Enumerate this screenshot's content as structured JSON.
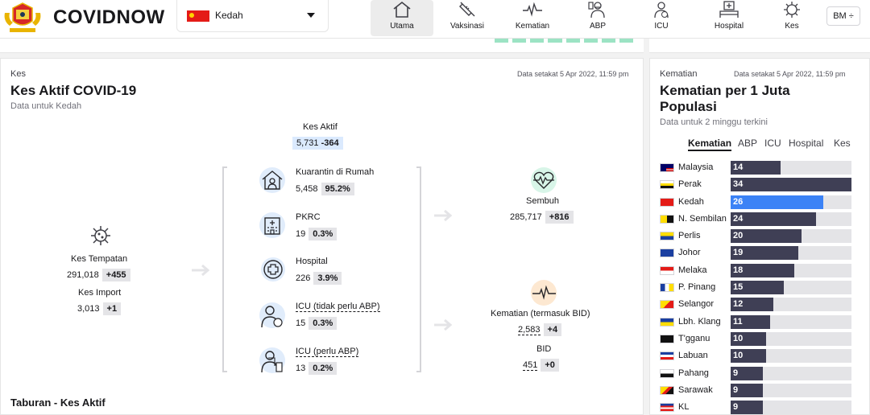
{
  "header": {
    "brand": "COVIDNOW",
    "state": "Kedah",
    "nav": [
      {
        "label": "Utama",
        "icon": "home-icon",
        "active": true
      },
      {
        "label": "Vaksinasi",
        "icon": "syringe-icon",
        "active": false
      },
      {
        "label": "Kematian",
        "icon": "pulse-icon",
        "active": false
      },
      {
        "label": "ABP",
        "icon": "ventilator-patient-icon",
        "active": false
      },
      {
        "label": "ICU",
        "icon": "icu-doctor-icon",
        "active": false
      },
      {
        "label": "Hospital",
        "icon": "hospital-bed-icon",
        "active": false
      },
      {
        "label": "Kes",
        "icon": "virus-icon",
        "active": false
      }
    ],
    "language": "BM ÷"
  },
  "active_cases": {
    "section_tag": "Kes",
    "updated": "Data setakat 5 Apr 2022, 11:59 pm",
    "title": "Kes Aktif COVID-19",
    "subtitle": "Data untuk Kedah",
    "total": {
      "label": "Kes Aktif",
      "value": "5,731",
      "delta": "-364"
    },
    "local": {
      "label": "Kes Tempatan",
      "value": "291,018",
      "delta": "+455"
    },
    "import": {
      "label": "Kes Import",
      "value": "3,013",
      "delta": "+1"
    },
    "breakdown": [
      {
        "label": "Kuarantin di Rumah",
        "value": "5,458",
        "pct": "95.2%",
        "icon": "home-quarantine-icon"
      },
      {
        "label": "PKRC",
        "value": "19",
        "pct": "0.3%",
        "icon": "quarantine-centre-icon"
      },
      {
        "label": "Hospital",
        "value": "226",
        "pct": "3.9%",
        "icon": "medical-cross-icon"
      },
      {
        "label": "ICU (tidak perlu ABP)",
        "value": "15",
        "pct": "0.3%",
        "icon": "icu-patient-icon"
      },
      {
        "label": "ICU (perlu ABP)",
        "value": "13",
        "pct": "0.2%",
        "icon": "icu-ventilator-icon"
      }
    ],
    "recovered": {
      "label": "Sembuh",
      "value": "285,717",
      "delta": "+816"
    },
    "deaths": {
      "label": "Kematian (termasuk BID)",
      "value": "2,583",
      "delta": "+4"
    },
    "bid": {
      "label": "BID",
      "value": "451",
      "delta": "+0"
    },
    "next_section": "Taburan - Kes Aktif"
  },
  "deaths_panel": {
    "section_tag": "Kematian",
    "updated": "Data setakat 5 Apr 2022, 11:59 pm",
    "title_line1": "Kematian per 1 Juta",
    "title_line2": "Populasi",
    "subtitle": "Data untuk 2 minggu terkini",
    "tabs": [
      "Kematian",
      "ABP",
      "ICU",
      "Hospital",
      "Kes"
    ],
    "max_value": 34,
    "rows": [
      {
        "name": "Malaysia",
        "value": 14
      },
      {
        "name": "Perak",
        "value": 34
      },
      {
        "name": "Kedah",
        "value": 26,
        "highlight": true
      },
      {
        "name": "N. Sembilan",
        "value": 24
      },
      {
        "name": "Perlis",
        "value": 20
      },
      {
        "name": "Johor",
        "value": 19
      },
      {
        "name": "Melaka",
        "value": 18
      },
      {
        "name": "P. Pinang",
        "value": 15
      },
      {
        "name": "Selangor",
        "value": 12
      },
      {
        "name": "Lbh. Klang",
        "value": 11
      },
      {
        "name": "T'gganu",
        "value": 10
      },
      {
        "name": "Labuan",
        "value": 10
      },
      {
        "name": "Pahang",
        "value": 9
      },
      {
        "name": "Sarawak",
        "value": 9
      },
      {
        "name": "KL",
        "value": 9
      }
    ],
    "colors": {
      "bar": "#3f3f55",
      "highlight": "#3b82f6",
      "track": "#e4e4e7"
    }
  }
}
